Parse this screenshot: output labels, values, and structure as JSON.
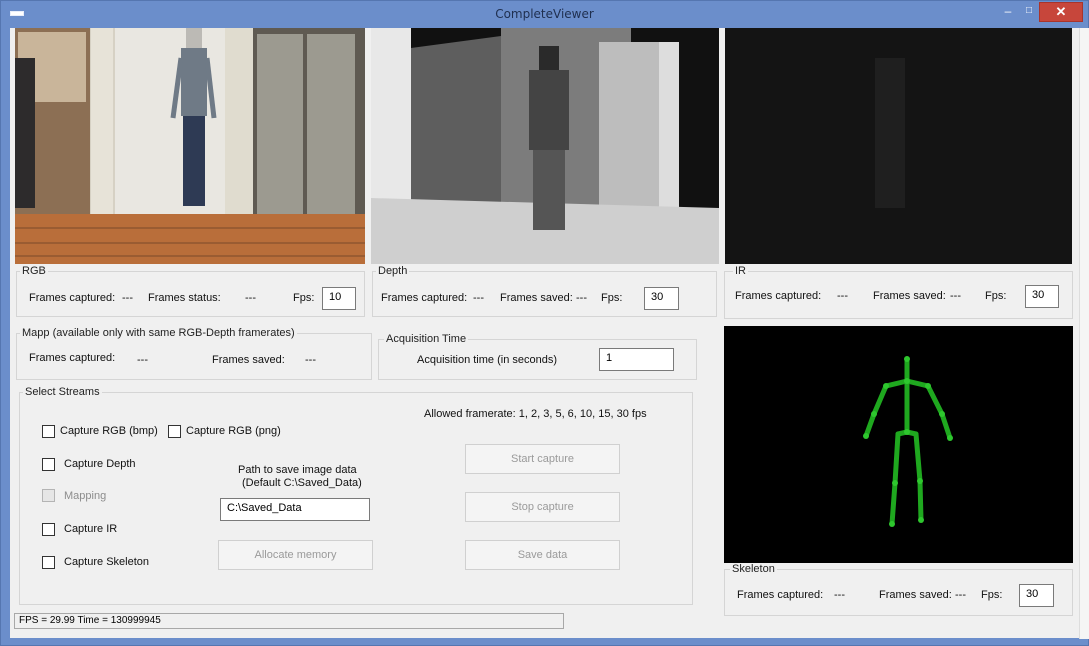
{
  "window": {
    "title": "CompleteViewer",
    "minimize": "–",
    "maximize": "□",
    "close": "✕"
  },
  "rgb": {
    "group_label": "RGB",
    "frames_captured_label": "Frames captured:",
    "frames_captured_value": "---",
    "frames_status_label": "Frames status:",
    "frames_status_value": "---",
    "fps_label": "Fps:",
    "fps_value": "10"
  },
  "depth": {
    "group_label": "Depth",
    "frames_captured_label": "Frames captured:",
    "frames_captured_value": "---",
    "frames_saved_label": "Frames saved:",
    "frames_saved_value": "---",
    "fps_label": "Fps:",
    "fps_value": "30"
  },
  "ir": {
    "group_label": "IR",
    "frames_captured_label": "Frames captured:",
    "frames_captured_value": "---",
    "frames_saved_label": "Frames saved:",
    "frames_saved_value": "---",
    "fps_label": "Fps:",
    "fps_value": "30"
  },
  "mapp": {
    "group_label": "Mapp   (available only with same RGB-Depth framerates)",
    "frames_captured_label": "Frames captured:",
    "frames_captured_value": "---",
    "frames_saved_label": "Frames saved:",
    "frames_saved_value": "---"
  },
  "acquisition": {
    "group_label": "Acquisition Time",
    "time_label": "Acquisition time (in seconds)",
    "time_value": "1"
  },
  "streams": {
    "group_label": "Select Streams",
    "allowed_framerate": "Allowed framerate: 1, 2, 3, 5, 6, 10, 15, 30 fps",
    "capture_rgb_bmp": "Capture RGB (bmp)",
    "capture_rgb_png": "Capture RGB (png)",
    "capture_depth": "Capture Depth",
    "mapping": "Mapping",
    "capture_ir": "Capture IR",
    "capture_skeleton": "Capture Skeleton",
    "path_label_1": "Path to save image data",
    "path_label_2": "(Default C:\\Saved_Data)",
    "path_value": "C:\\Saved_Data",
    "allocate_memory": "Allocate memory",
    "start_capture": "Start capture",
    "stop_capture": "Stop capture",
    "save_data": "Save data"
  },
  "skeleton": {
    "group_label": "Skeleton",
    "frames_captured_label": "Frames captured:",
    "frames_captured_value": "---",
    "frames_saved_label": "Frames saved:",
    "frames_saved_value": "---",
    "fps_label": "Fps:",
    "fps_value": "30"
  },
  "status_bar": {
    "text": "FPS = 29.99   Time = 130999945"
  },
  "colors": {
    "title_bar": "#6b8ecb",
    "close_button": "#c7463b",
    "skeleton_green": "#1fa81f",
    "client_bg": "#f0f0f0"
  }
}
